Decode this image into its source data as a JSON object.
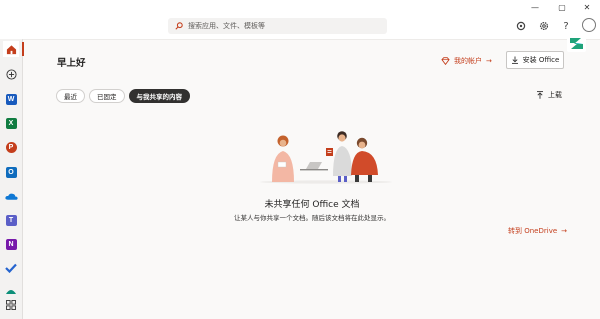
{
  "search": {
    "placeholder": "搜索应用、文件、模板等"
  },
  "main": {
    "greeting": "早上好",
    "my_account": "我的帐户",
    "install_office": "安装 Office",
    "tabs": [
      {
        "label": "最近"
      },
      {
        "label": "已固定"
      },
      {
        "label": "与我共享的内容"
      }
    ],
    "upload": "上载",
    "empty_title": "未共享任何 Office 文档",
    "empty_subtitle": "让某人与你共享一个文档。随后该文档将在此处显示。",
    "onedrive_link": "转到 OneDrive"
  },
  "window": {
    "min": "—",
    "max": "▢",
    "close": "✕"
  },
  "header_icons": [
    "copilot-icon",
    "settings-icon",
    "help-icon",
    "account-avatar"
  ],
  "rail_apps": [
    "home",
    "create",
    "word",
    "excel",
    "powerpoint",
    "outlook",
    "onedrive",
    "teams",
    "onenote",
    "todo",
    "more-app",
    "apps"
  ],
  "colors": {
    "accent": "#c43e1c",
    "word": "#185abd",
    "excel": "#107c41",
    "powerpoint": "#c43e1c",
    "outlook": "#0f6cbd",
    "onedrive": "#0f78d4",
    "teams": "#5b5fc7",
    "onenote": "#7719aa",
    "todo": "#2564cf"
  }
}
